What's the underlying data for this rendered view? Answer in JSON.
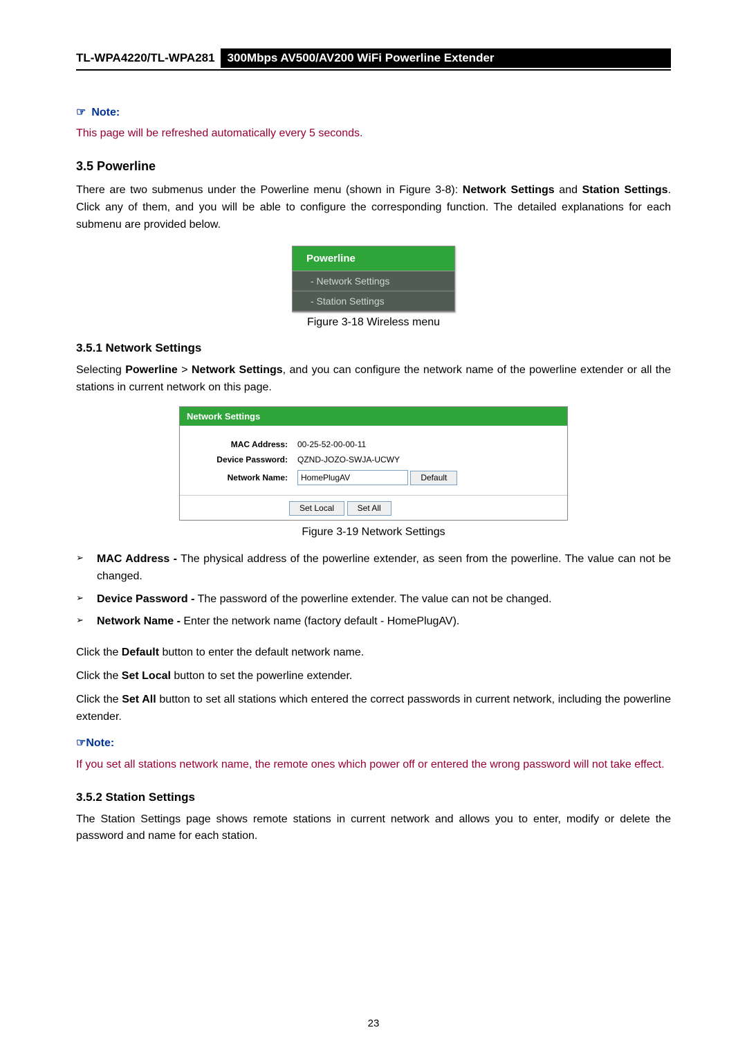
{
  "header": {
    "model": "TL-WPA4220/TL-WPA281",
    "product": "300Mbps AV500/AV200 WiFi Powerline Extender"
  },
  "note1": {
    "icon": "☞",
    "label": "Note:",
    "body": "This page will be refreshed automatically every 5 seconds."
  },
  "section": {
    "heading": "3.5 Powerline",
    "intro_pre": "There are two submenus under the Powerline menu (shown in Figure 3-8): ",
    "intro_b1": "Network Settings",
    "intro_mid": " and ",
    "intro_b2": "Station Settings",
    "intro_post": ". Click any of them, and you will be able to configure the corresponding function. The detailed explanations for each submenu are provided below."
  },
  "menu_fig": {
    "head": "Powerline",
    "row1": "- Network Settings",
    "row2": "- Station Settings",
    "caption": "Figure 3-18 Wireless menu"
  },
  "subsect1": {
    "heading": "3.5.1 Network Settings",
    "intro_pre": "Selecting ",
    "b1": "Powerline",
    "sep": " > ",
    "b2": "Network Settings",
    "intro_post": ", and you can configure the network name of the powerline extender or all the stations in current network on this page."
  },
  "network_settings_panel": {
    "title": "Network Settings",
    "mac_label": "MAC Address:",
    "mac_value": "00-25-52-00-00-11",
    "pwd_label": "Device Password:",
    "pwd_value": "QZND-JOZO-SWJA-UCWY",
    "name_label": "Network Name:",
    "name_value": "HomePlugAV",
    "default_btn": "Default",
    "set_local_btn": "Set Local",
    "set_all_btn": "Set All",
    "caption": "Figure 3-19 Network Settings"
  },
  "bullets": {
    "mark": "➢",
    "mac_b": "MAC Address -",
    "mac_txt": " The physical address of the powerline extender, as seen from the powerline. The value can not be changed.",
    "pwd_b": "Device Password -",
    "pwd_txt": " The password of the powerline extender. The value can not be changed.",
    "name_b": "Network Name -",
    "name_txt": " Enter the network name (factory default - HomePlugAV)."
  },
  "click_txt": {
    "p1_pre": "Click the ",
    "p1_b": "Default",
    "p1_post": " button to enter the default network name.",
    "p2_pre": "Click the ",
    "p2_b": "Set Local",
    "p2_post": " button to set the powerline extender.",
    "p3_pre": "Click the ",
    "p3_b": "Set All",
    "p3_post": " button to set all stations which entered the correct passwords in current network, including the powerline extender."
  },
  "note2": {
    "icon": "☞",
    "label": "Note:",
    "body": "If you set all stations network name, the remote ones which power off or entered the wrong password will not take effect."
  },
  "subsect2": {
    "heading": "3.5.2 Station Settings",
    "intro": "The Station Settings page shows remote stations in current network and allows you to enter, modify or delete the password and name for each station."
  },
  "page_number": "23"
}
